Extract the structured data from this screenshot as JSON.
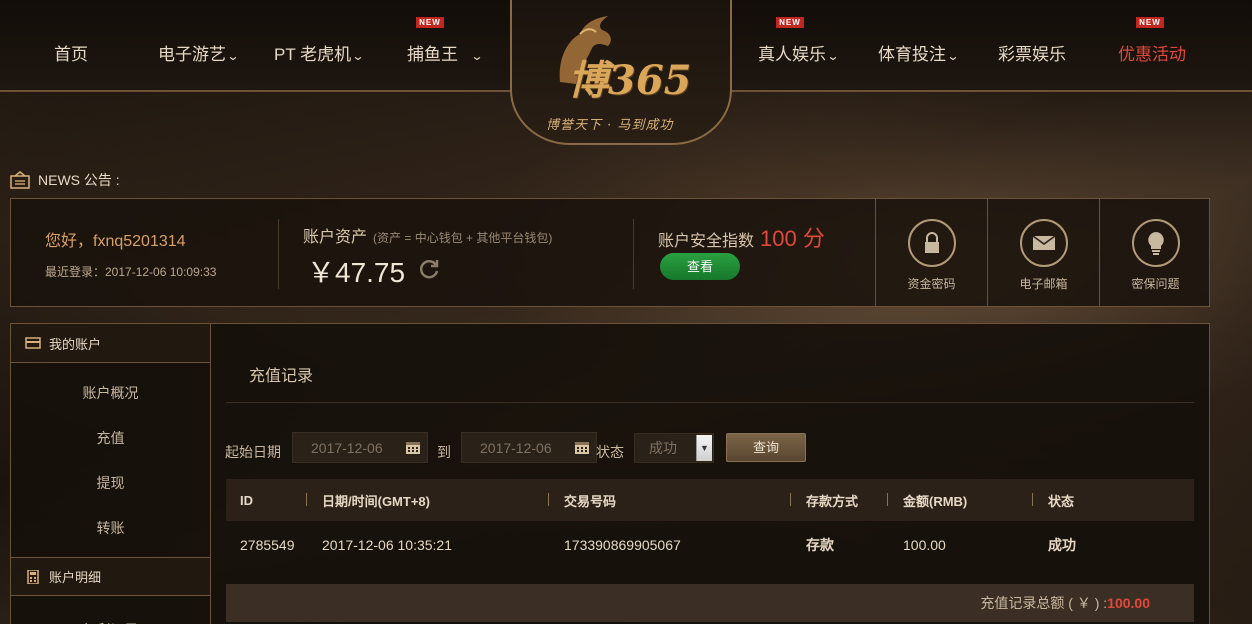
{
  "nav": {
    "items": [
      {
        "label": "首页",
        "has_chevron": false,
        "is_new": false
      },
      {
        "label": "电子游艺",
        "has_chevron": true,
        "is_new": false
      },
      {
        "label": "PT 老虎机",
        "has_chevron": true,
        "is_new": false
      },
      {
        "label": "捕鱼王",
        "has_chevron": true,
        "is_new": true
      },
      {
        "label": "真人娱乐",
        "has_chevron": true,
        "is_new": true
      },
      {
        "label": "体育投注",
        "has_chevron": true,
        "is_new": false
      },
      {
        "label": "彩票娱乐",
        "has_chevron": false,
        "is_new": false
      },
      {
        "label": "优惠活动",
        "has_chevron": false,
        "is_new": true
      }
    ],
    "new_badge": "NEW",
    "chevron": "⌄"
  },
  "logo": {
    "main_text": "博365",
    "slogan": "博誉天下 · 马到成功"
  },
  "news": {
    "label": "NEWS 公告 :"
  },
  "account": {
    "greeting": "您好，fxnq5201314",
    "last_login": "最近登录：2017-12-06 10:09:33",
    "assets_title": "账户资产",
    "assets_note": "(资产 = 中心钱包 + 其他平台钱包)",
    "balance": "￥47.75",
    "security_title": "账户安全指数",
    "security_score": "100 分",
    "view_button": "查看",
    "tiles": [
      {
        "label": "资金密码",
        "icon": "lock-icon"
      },
      {
        "label": "电子邮箱",
        "icon": "envelope-icon"
      },
      {
        "label": "密保问题",
        "icon": "lightbulb-icon"
      }
    ]
  },
  "sidebar": {
    "section1_title": "我的账户",
    "section1_items": [
      "账户概况",
      "充值",
      "提现",
      "转账"
    ],
    "section2_title": "账户明细",
    "section2_items": [
      "红利记录"
    ]
  },
  "main": {
    "title": "充值记录",
    "filter": {
      "start_label": "起始日期",
      "start_value": "2017-12-06",
      "to_label": "到",
      "end_value": "2017-12-06",
      "status_label": "状态",
      "status_value": "成功",
      "query_button": "查询"
    },
    "table": {
      "headers": [
        "ID",
        "日期/时间(GMT+8)",
        "交易号码",
        "存款方式",
        "金额(RMB)",
        "状态"
      ],
      "rows": [
        [
          "2785549",
          "2017-12-06 10:35:21",
          "173390869905067",
          "存款",
          "100.00",
          "成功"
        ]
      ]
    },
    "total_label": "充值记录总额 ( ￥ ) :",
    "total_value": "100.00"
  },
  "colors": {
    "accent_red": "#e0483a",
    "gold_border": "#6b5238",
    "green_button": "#2aa041"
  }
}
